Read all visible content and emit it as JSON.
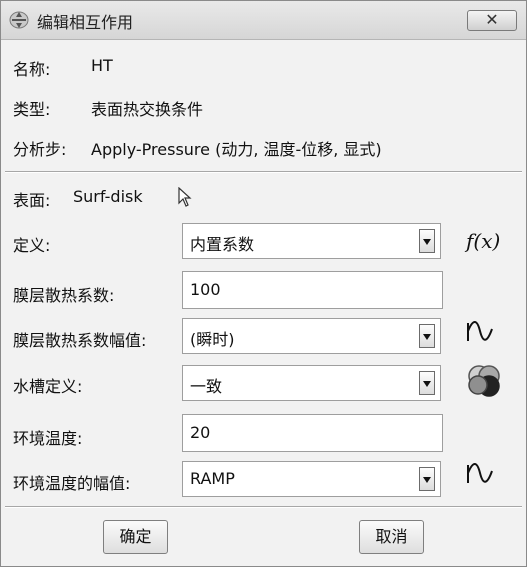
{
  "window": {
    "title": "编辑相互作用"
  },
  "info": {
    "name_label": "名称:",
    "name_value": "HT",
    "type_label": "类型:",
    "type_value": "表面热交换条件",
    "step_label": "分析步:",
    "step_value": "Apply-Pressure (动力, 温度-位移, 显式)"
  },
  "surface": {
    "label": "表面:",
    "value": "Surf-disk"
  },
  "fields": {
    "definition": {
      "label": "定义:",
      "value": "内置系数"
    },
    "film_coeff": {
      "label": "膜层散热系数:",
      "value": "100"
    },
    "film_amp": {
      "label": "膜层散热系数幅值:",
      "value": "(瞬时)"
    },
    "sink_def": {
      "label": "水槽定义:",
      "value": "一致"
    },
    "sink_temp": {
      "label": "环境温度:",
      "value": "20"
    },
    "sink_amp": {
      "label": "环境温度的幅值:",
      "value": "RAMP"
    }
  },
  "icons": {
    "function": "f(x)"
  },
  "buttons": {
    "ok": "确定",
    "cancel": "取消"
  }
}
